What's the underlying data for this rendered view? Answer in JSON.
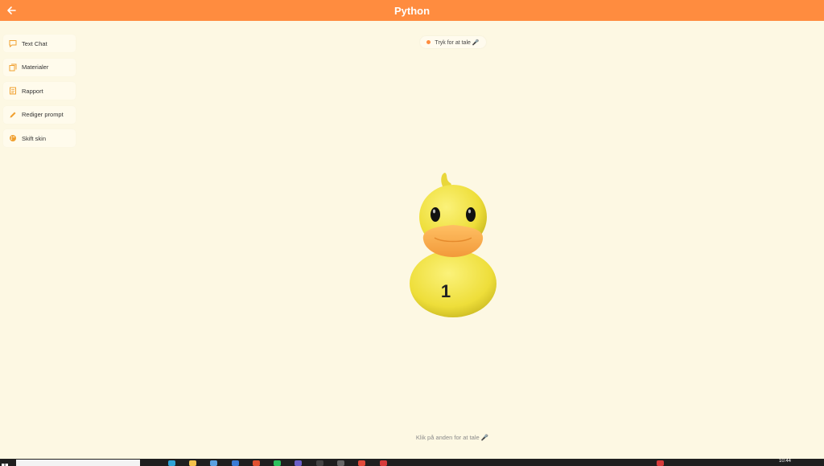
{
  "header": {
    "title": "Python",
    "back_icon": "arrow-left-icon"
  },
  "sidebar": {
    "items": [
      {
        "label": "Text Chat",
        "icon": "chat-bubble-icon"
      },
      {
        "label": "Materialer",
        "icon": "documents-icon"
      },
      {
        "label": "Rapport",
        "icon": "report-icon"
      },
      {
        "label": "Rediger prompt",
        "icon": "pencil-icon"
      },
      {
        "label": "Skift skin",
        "icon": "palette-icon"
      }
    ]
  },
  "voice": {
    "button_label": "Tryk for at tale 🎤",
    "hint": "Klik på anden for at tale 🎤"
  },
  "duck": {
    "number": "1"
  },
  "taskbar": {
    "clock": "10:44"
  },
  "colors": {
    "accent": "#ff8c3f",
    "background": "#fdf8e3",
    "duck": "#f2e24a",
    "beak": "#f7a84a"
  }
}
